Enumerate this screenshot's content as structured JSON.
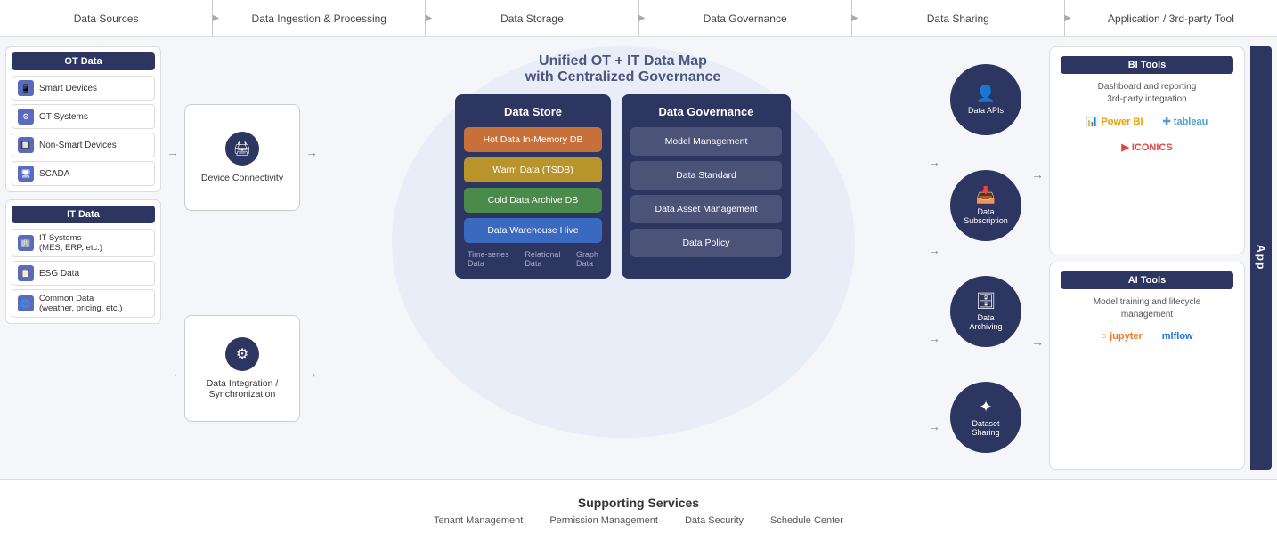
{
  "pipeline": {
    "steps": [
      "Data Sources",
      "Data Ingestion & Processing",
      "Data Storage",
      "Data Governance",
      "Data Sharing",
      "Application / 3rd-party Tool"
    ]
  },
  "ot_data": {
    "header": "OT Data",
    "items": [
      {
        "label": "Smart Devices",
        "icon": "📱"
      },
      {
        "label": "OT Systems",
        "icon": "⚙"
      },
      {
        "label": "Non-Smart Devices",
        "icon": "🔲"
      },
      {
        "label": "SCADA",
        "icon": "🖥"
      }
    ]
  },
  "it_data": {
    "header": "IT Data",
    "items": [
      {
        "label": "IT Systems\n(MES, ERP, etc.)",
        "icon": "🏢"
      },
      {
        "label": "ESG Data",
        "icon": "📋"
      },
      {
        "label": "Common Data\n(weather, pricing, etc.)",
        "icon": "🌐"
      }
    ]
  },
  "connectivity": {
    "device": "Device Connectivity",
    "integration": "Data Integration /\nSynchronization"
  },
  "center_title": "Unified OT + IT Data Map\nwith Centralized Governance",
  "data_store": {
    "title": "Data Store",
    "items": [
      {
        "label": "Hot Data In-Memory DB",
        "type": "hot"
      },
      {
        "label": "Warm Data (TSDB)",
        "type": "warm"
      },
      {
        "label": "Cold Data Archive DB",
        "type": "cold"
      },
      {
        "label": "Data Warehouse Hive",
        "type": "warehouse"
      }
    ],
    "labels": [
      "Time-series\nData",
      "Relational\nData",
      "Graph\nData"
    ]
  },
  "data_governance": {
    "title": "Data Governance",
    "items": [
      "Model Management",
      "Data Standard",
      "Data Asset Management",
      "Data Policy"
    ]
  },
  "data_sharing": {
    "circles": [
      {
        "icon": "👤",
        "label": "Data APIs"
      },
      {
        "icon": "📥",
        "label": "Data\nSubscription"
      },
      {
        "icon": "🗄",
        "label": "Data\nArchiving"
      },
      {
        "icon": "✦",
        "label": "Dataset\nSharing"
      }
    ]
  },
  "bi_tools": {
    "header": "BI Tools",
    "description": "Dashboard and reporting\n3rd-party integration",
    "logos": [
      "Power BI",
      "+ tableau",
      "▶ ICONICS"
    ]
  },
  "ai_tools": {
    "header": "AI Tools",
    "description": "Model training and lifecycle\nmanagement",
    "logos": [
      "jupyter",
      "mlflow"
    ]
  },
  "app_label": "App",
  "supporting": {
    "title": "Supporting Services",
    "items": [
      "Tenant Management",
      "Permission Management",
      "Data Security",
      "Schedule Center"
    ]
  }
}
